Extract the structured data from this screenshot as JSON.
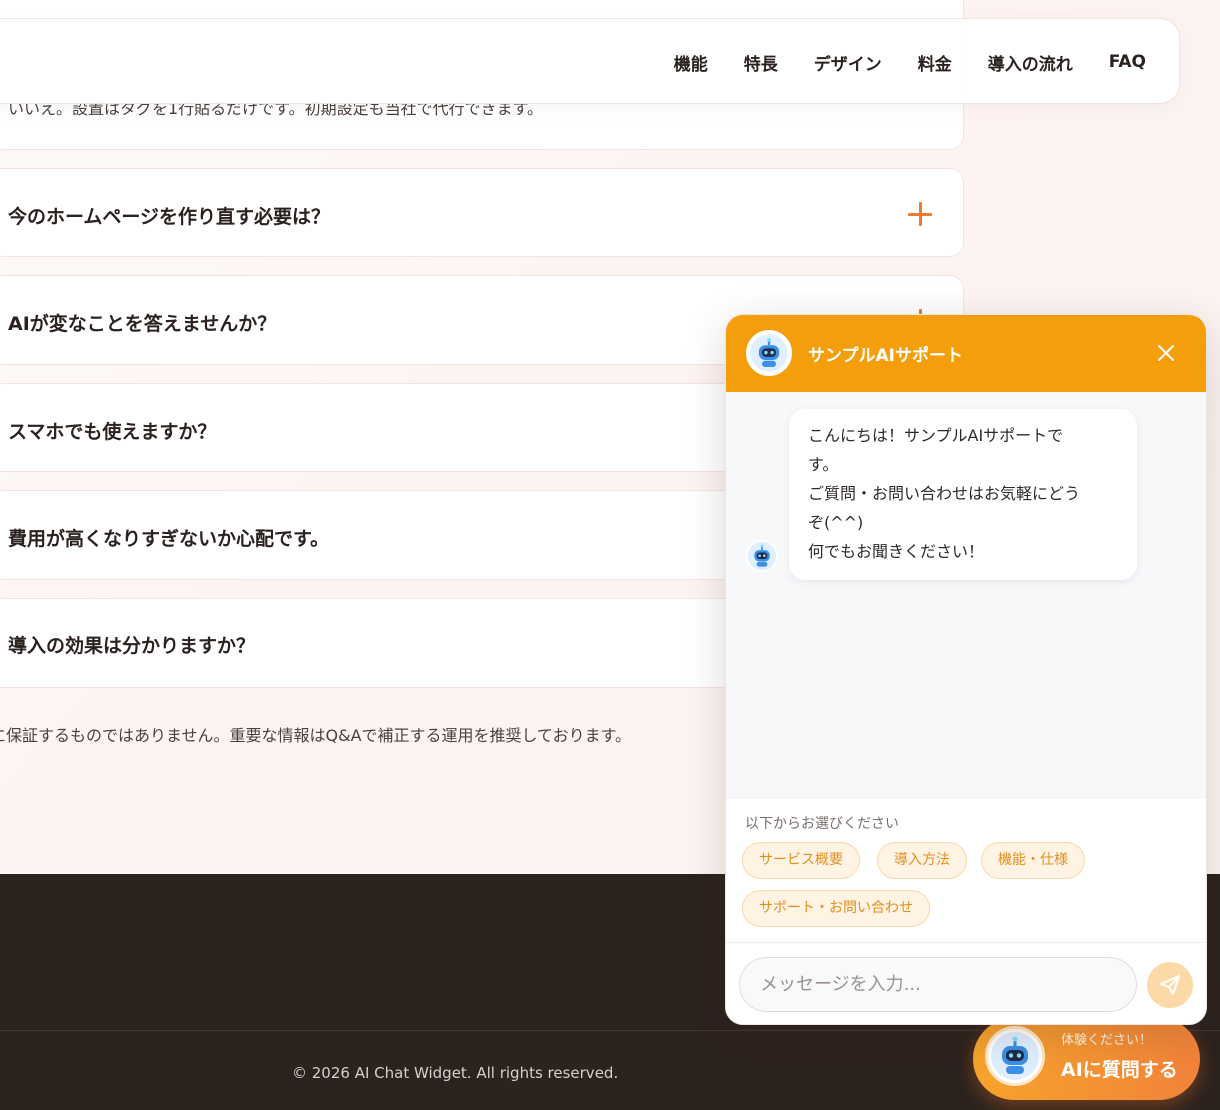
{
  "nav": {
    "items": [
      {
        "label": "機能"
      },
      {
        "label": "特長"
      },
      {
        "label": "デザイン"
      },
      {
        "label": "料金"
      },
      {
        "label": "導入の流れ"
      },
      {
        "label": "FAQ"
      }
    ]
  },
  "faq": {
    "answer_partial": "いいえ。設置はタグを1行貼るだけです。初期設定も当社で代行できます。",
    "items": [
      {
        "question": "今のホームページを作り直す必要は？"
      },
      {
        "question": "AIが変なことを答えませんか？"
      },
      {
        "question": "スマホでも使えますか？"
      },
      {
        "question": "費用が高くなりすぎないか心配です。"
      },
      {
        "question": "導入の効果は分かりますか？"
      }
    ],
    "note": "に保証するものではありません。重要な情報はQ&Aで補正する運用を推奨しております。"
  },
  "footer": {
    "copyright": "© 2026 AI Chat Widget. All rights reserved."
  },
  "launcher": {
    "sub_label": "体験ください！",
    "main_label": "AIに質問する"
  },
  "chat": {
    "title": "サンプルAIサポート",
    "message_lines": [
      "こんにちは！サンプルAIサポートで",
      "す。",
      "ご質問・お問い合わせはお気軽にどう",
      "ぞ(^^)",
      "何でもお聞きください！"
    ],
    "quick_label": "以下からお選びください",
    "quick_replies": [
      {
        "label": "サービス概要"
      },
      {
        "label": "導入方法"
      },
      {
        "label": "機能・仕様"
      },
      {
        "label": "サポート・お問い合わせ"
      }
    ],
    "input_placeholder": "メッセージを入力..."
  },
  "colors": {
    "accent": "#f59e0b",
    "plus_icon": "#f07a2d",
    "footer_bg": "#2c221e"
  }
}
